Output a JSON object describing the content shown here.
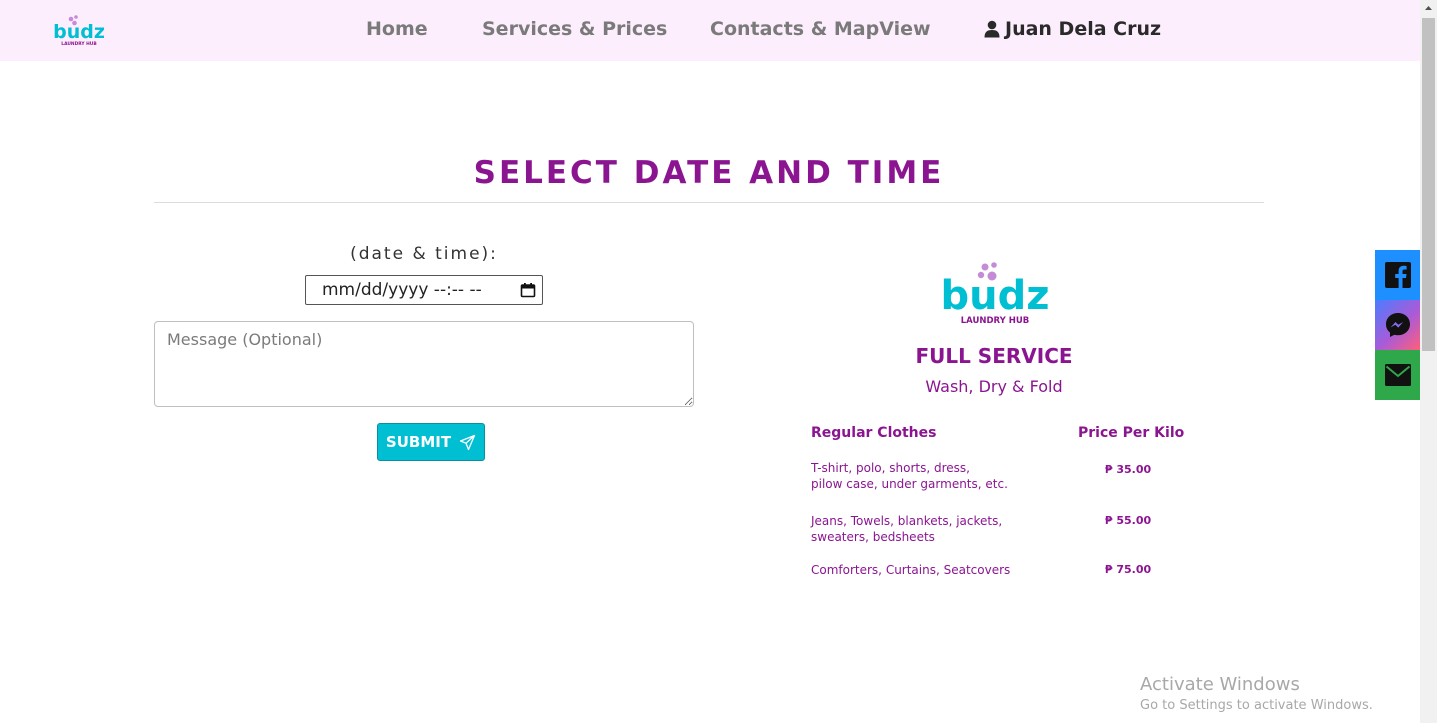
{
  "brand": {
    "wordmark": "budz",
    "tagline": "LAUNDRY HUB",
    "colors": {
      "teal": "#00bfd3",
      "purple": "#8b1591",
      "bubble": "#c48bd6"
    }
  },
  "nav": {
    "items": [
      {
        "label": "Home"
      },
      {
        "label": "Services & Prices"
      },
      {
        "label": "Contacts & MapView"
      }
    ],
    "user_name": "Juan Dela Cruz",
    "user_icon": "user-icon"
  },
  "page": {
    "title": "SELECT DATE AND TIME",
    "title_color": "#8b1591"
  },
  "form": {
    "datetime_label": "(date & time):",
    "datetime_value": "mm/dd/yyyy --:-- --",
    "message_placeholder": "Message (Optional)",
    "message_value": "",
    "submit_label": "SUBMIT",
    "submit_icon": "send-icon",
    "submit_color": "#00bfd3"
  },
  "price_card": {
    "service_title": "FULL SERVICE",
    "service_subtitle": "Wash, Dry & Fold",
    "col_item": "Regular Clothes",
    "col_price": "Price Per Kilo",
    "rows": [
      {
        "line1": "T-shirt, polo, shorts, dress,",
        "line2": "pilow case, under garments, etc.",
        "price": "₱ 35.00"
      },
      {
        "line1": "Jeans, Towels, blankets, jackets,",
        "line2": "sweaters, bedsheets",
        "price": "₱ 55.00"
      },
      {
        "line1": "Comforters, Curtains, Seatcovers",
        "line2": "",
        "price": "₱ 75.00"
      }
    ]
  },
  "social": [
    {
      "icon": "facebook-icon",
      "color": "#1e8fff"
    },
    {
      "icon": "messenger-icon",
      "color": "#a95bd8"
    },
    {
      "icon": "mail-icon",
      "color": "#2ea84a"
    }
  ],
  "watermark": {
    "title": "Activate Windows",
    "subtitle": "Go to Settings to activate Windows."
  }
}
